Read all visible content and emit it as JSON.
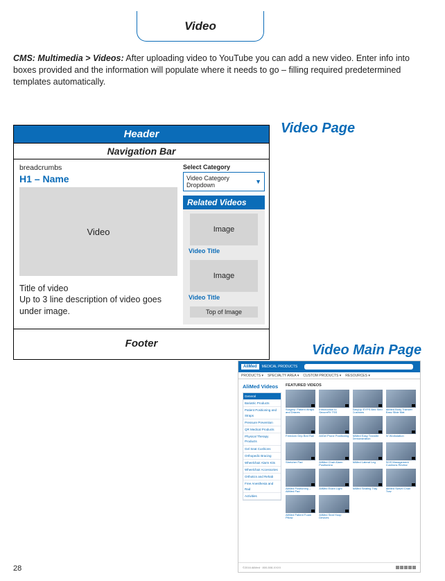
{
  "tab": {
    "label": "Video"
  },
  "intro": {
    "prefix": "CMS: Multimedia > Videos:",
    "text": " After uploading video to YouTube you can add a new video. Enter info into boxes provided and the information will populate where it needs to go – filling required predetermined templates automatically."
  },
  "titles": {
    "video_page": "Video Page",
    "video_main": "Video Main Page"
  },
  "wireframe": {
    "header": "Header",
    "nav": "Navigation Bar",
    "breadcrumbs": "breadcrumbs",
    "h1": "H1 – Name",
    "video_box": "Video",
    "title_line": "Title of video",
    "desc_line": "Up to 3 line description of video goes under image.",
    "select_label": "Select Category",
    "dropdown": "Video Category Dropdown",
    "related_header": "Related Videos",
    "image_label": "Image",
    "video_title": "Video Title",
    "top_of_image": "Top of Image",
    "footer": "Footer"
  },
  "main": {
    "logo": "AliMed",
    "topbar_title": "MEDICAL PRODUCTS",
    "nav_items": [
      "PRODUCTS ▾",
      "SPECIALTY AREA ▾",
      "CUSTOM PRODUCTS ▾",
      "RESOURCES ▾"
    ],
    "page_title": "AliMed Videos",
    "featured": "FEATURED VIDEOS",
    "side_items": [
      "General",
      "Bariatric Products",
      "Patient Positioning and Straps",
      "Pressure Prevention",
      "QR Medical Products",
      "Physical Therapy Products",
      "Gel Seat Cushions",
      "Orthopedic Bracing",
      "Wheelchair Alarm Kits",
      "Wheelchair Accessories",
      "Orthotics and Rehab",
      "Free Anesthesia and Rad",
      "Activities"
    ],
    "grid_captions": [
      "Surgery: Patient Wraps and Drapes",
      "Introduction to SecureFit TSS",
      "EasyUp EYPS Bed Sled Cushions",
      "AliMed Body Transfer Easy Slide Mat",
      "Freedom Grip Bed Rail",
      "AliGel Prone Positioning",
      "AliMed Easy Transfer Demonstration",
      "IV Workstation",
      "Stretcher Pad",
      "AliMed Chair Alarm Positioning",
      "AliMed Lateral Leg",
      "SOS Management Cushions Review",
      "AliMed Positioning – AliMed Pad",
      "AliMed Exam Light",
      "AliMed Seating Tray",
      "AliMed Swivel Chair Tray",
      "AliMed Patient Foam Pillow",
      "AliMed Seat Hoop Devices"
    ]
  },
  "page_number": "28"
}
